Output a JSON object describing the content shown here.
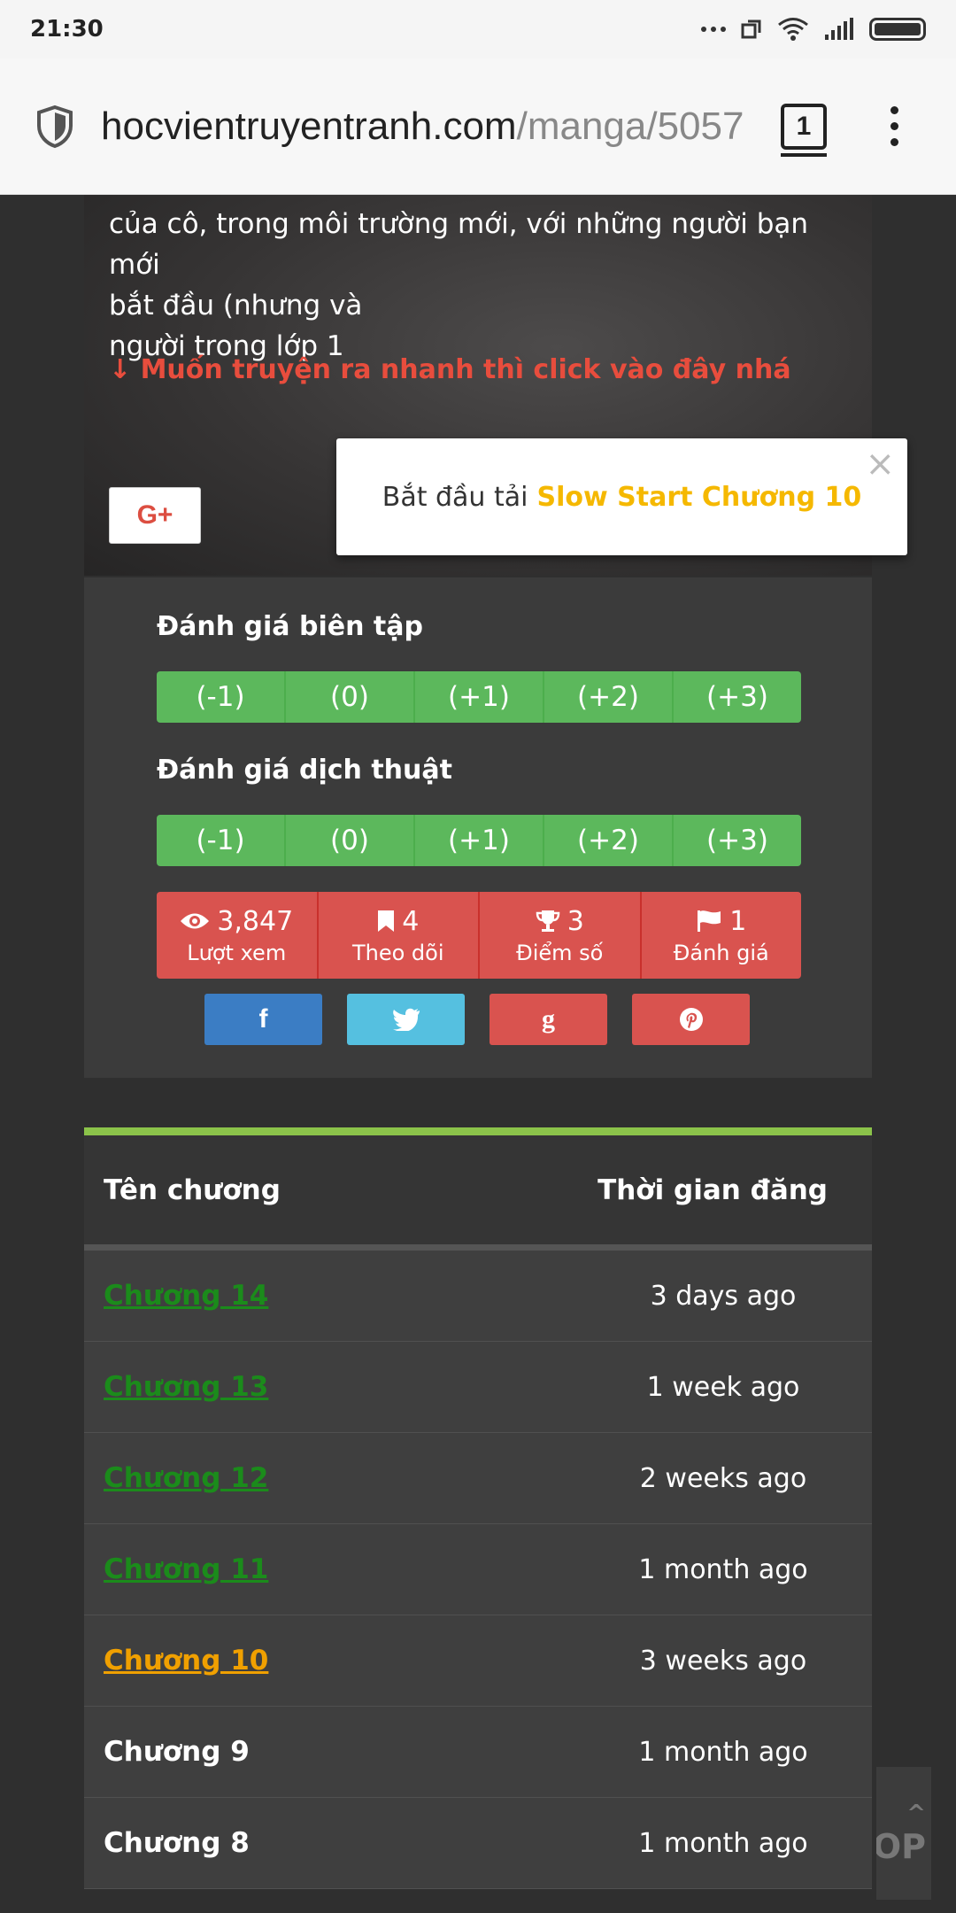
{
  "status_bar": {
    "time": "21:30"
  },
  "browser": {
    "url_host": "hocvientruyentranh.com",
    "url_path": "/manga/5057",
    "tab_count": "1"
  },
  "hero": {
    "description_lines": [
      "của cô, trong môi trường mới, với những người bạn mới",
      "bắt đầu (nhưng và",
      "người trong lớp 1"
    ],
    "cta": "↓ Muốn truyện ra nhanh thì click vào đây nhá",
    "gplus_label": "G+"
  },
  "toast": {
    "prefix": "Bắt đầu tải",
    "highlight": "Slow Start Chương 10",
    "close": "×"
  },
  "editor_rating": {
    "title": "Đánh giá biên tập",
    "options": [
      "(-1)",
      "(0)",
      "(+1)",
      "(+2)",
      "(+3)"
    ]
  },
  "translation_rating": {
    "title": "Đánh giá dịch thuật",
    "options": [
      "(-1)",
      "(0)",
      "(+1)",
      "(+2)",
      "(+3)"
    ]
  },
  "stats": [
    {
      "icon": "eye-icon",
      "value": "3,847",
      "label": "Lượt xem"
    },
    {
      "icon": "bookmark-icon",
      "value": "4",
      "label": "Theo dõi"
    },
    {
      "icon": "trophy-icon",
      "value": "3",
      "label": "Điểm số"
    },
    {
      "icon": "flag-icon",
      "value": "1",
      "label": "Đánh giá"
    }
  ],
  "share_buttons": [
    {
      "name": "facebook",
      "glyph": "f",
      "color": "#3b7dc4"
    },
    {
      "name": "twitter",
      "glyph": "🐦",
      "color": "#55c0e0"
    },
    {
      "name": "google",
      "glyph": "g",
      "color": "#d9534f"
    },
    {
      "name": "pinterest",
      "glyph": "P",
      "color": "#d9534f"
    }
  ],
  "chapters": {
    "col_name": "Tên chương",
    "col_time": "Thời gian đăng",
    "rows": [
      {
        "name": "Chương 14",
        "time": "3 days ago",
        "state": "visited"
      },
      {
        "name": "Chương 13",
        "time": "1 week ago",
        "state": "visited"
      },
      {
        "name": "Chương 12",
        "time": "2 weeks ago",
        "state": "visited"
      },
      {
        "name": "Chương 11",
        "time": "1 month ago",
        "state": "visited"
      },
      {
        "name": "Chương 10",
        "time": "3 weeks ago",
        "state": "current"
      },
      {
        "name": "Chương 9",
        "time": "1 month ago",
        "state": "plain"
      },
      {
        "name": "Chương 8",
        "time": "1 month ago",
        "state": "plain"
      }
    ]
  },
  "to_top": {
    "label": "OP"
  },
  "colors": {
    "accent_green": "#8bc34a",
    "rating_green": "#5cb85c",
    "stat_red": "#d9534f",
    "visited_link": "#1b8b1b",
    "current_link": "#f0a000",
    "cta_red": "#e84d3d",
    "toast_highlight": "#f5b800"
  }
}
